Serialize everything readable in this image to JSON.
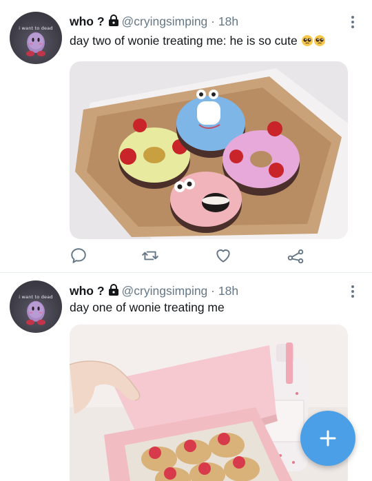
{
  "feed": [
    {
      "avatar_caption": "i want to dead",
      "display_name": "who ?",
      "handle": "@cryingsimping",
      "separator": "·",
      "time": "18h",
      "text": "day two of wonie treating me: he is so cute",
      "emoji": "pleading-face-emoji x2",
      "media_description_icon": "donut-box-photo",
      "actions": [
        "reply-icon",
        "retweet-icon",
        "like-icon",
        "share-icon"
      ]
    },
    {
      "avatar_caption": "i want to dead",
      "display_name": "who ?",
      "handle": "@cryingsimping",
      "separator": "·",
      "time": "18h",
      "text": "day one of wonie treating me",
      "media_description_icon": "strawberry-pastry-box-photo"
    }
  ],
  "colors": {
    "accent": "#4b9fe6",
    "secondary_text": "#657786",
    "divider": "#e6ecf0",
    "icon_gray": "#657786"
  },
  "fab_icon": "plus-icon"
}
